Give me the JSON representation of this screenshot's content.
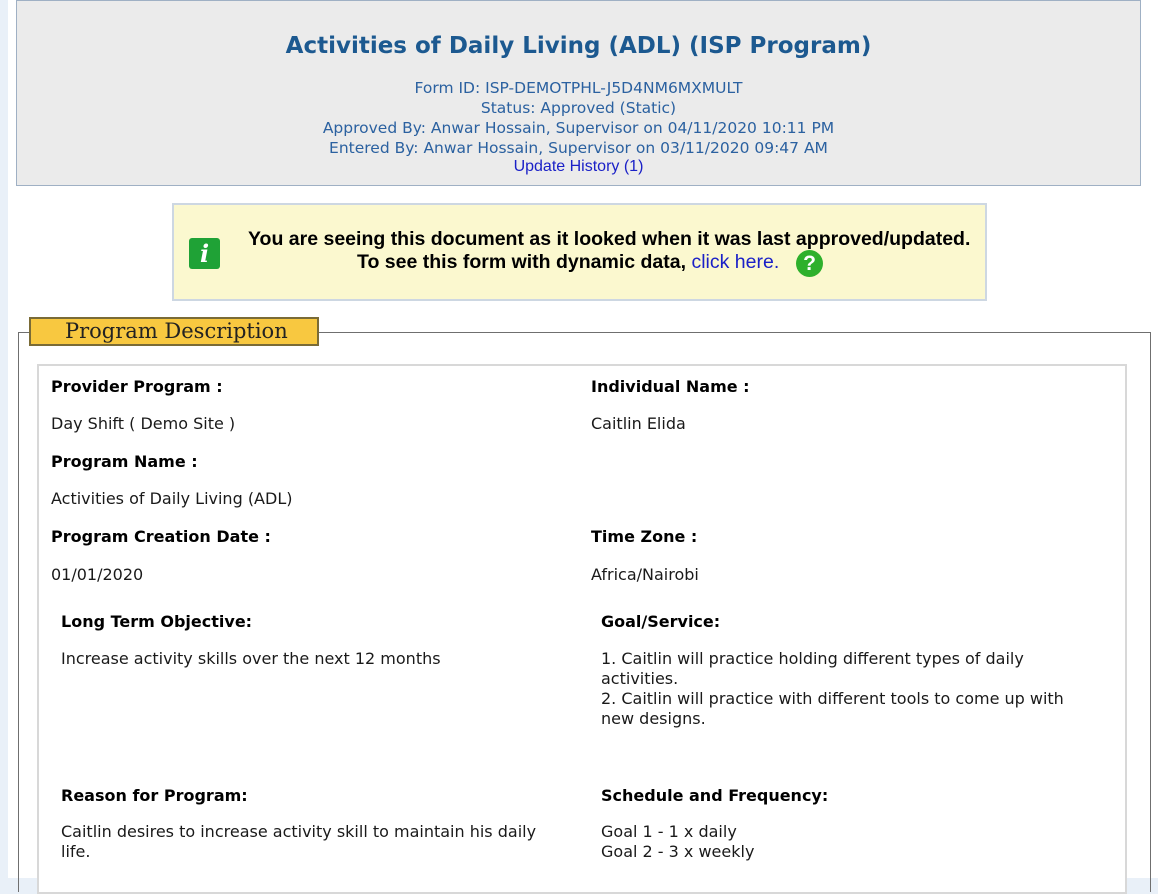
{
  "header": {
    "title": "Activities of Daily Living (ADL) (ISP Program)",
    "form_id": "Form ID: ISP-DEMOTPHL-J5D4NM6MXMULT",
    "status": "Status:  Approved (Static)",
    "approved_by": "Approved By: Anwar Hossain, Supervisor on 04/11/2020 10:11 PM",
    "entered_by": "Entered By: Anwar Hossain, Supervisor  on 03/11/2020 09:47 AM",
    "update_history": "Update History  (1)"
  },
  "notice": {
    "line1": "You are seeing this document as it looked when it was last approved/updated.",
    "line2": "To see this form with dynamic data,",
    "click_here": "click here.",
    "info_icon": "i",
    "help_icon": "?"
  },
  "section": {
    "title": "Program Description",
    "provider_program_label": "Provider Program :",
    "provider_program_value": "Day Shift ( Demo Site )",
    "individual_name_label": "Individual Name :",
    "individual_name_value": "Caitlin Elida",
    "program_name_label": "Program Name :",
    "program_name_value": "Activities of Daily Living (ADL)",
    "creation_date_label": "Program Creation Date :",
    "creation_date_value": "01/01/2020",
    "time_zone_label": "Time Zone :",
    "time_zone_value": "Africa/Nairobi",
    "long_term_objective_label": "Long Term Objective:",
    "long_term_objective_value": "Increase activity skills over the next 12 months",
    "goal_service_label": "Goal/Service:",
    "goal_service_value": "1. Caitlin will practice holding different types of daily\nactivities.\n2. Caitlin will practice with different tools to come up with\nnew designs.",
    "reason_label": "Reason for Program:",
    "reason_value": "Caitlin desires to increase activity skill to maintain his daily\nlife.",
    "schedule_label": "Schedule and Frequency:",
    "schedule_value": "Goal 1 - 1 x daily\nGoal 2 - 3 x weekly"
  }
}
